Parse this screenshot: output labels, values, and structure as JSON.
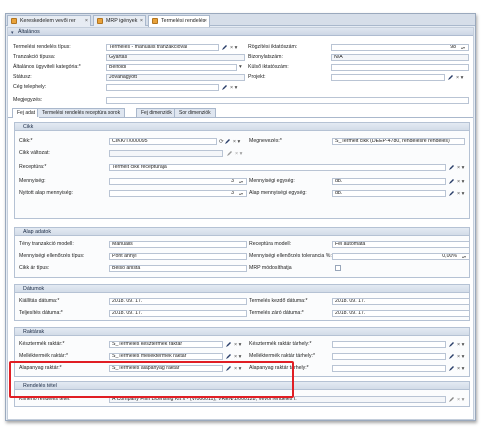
{
  "tabs": [
    {
      "label": "Kereskedelem vevői rer",
      "close": "×"
    },
    {
      "label": "MRP igények",
      "close": "×"
    },
    {
      "label": "Termelési rendelés",
      "close": "×"
    }
  ],
  "general": {
    "header": "Általános",
    "left": [
      {
        "label": "Termelési rendelés típus:",
        "value": "Termelés - manuális tranzakcióval"
      },
      {
        "label": "Tranzakció típusa:",
        "value": "Gyártás"
      },
      {
        "label": "Általános ügyviteli kategória:*",
        "value": "Belföldi"
      },
      {
        "label": "Státusz:",
        "value": "Jóváhagyott"
      },
      {
        "label": "Cég telephely:",
        "value": ""
      }
    ],
    "right": [
      {
        "label": "Rögzítési iktatószám:",
        "value": "98"
      },
      {
        "label": "Bizonylatszám:",
        "value": "N/A"
      },
      {
        "label": "Külső iktatószám:",
        "value": ""
      },
      {
        "label": "Projekt:",
        "value": ""
      }
    ],
    "remark_label": "Megjegyzés:",
    "remark_value": ""
  },
  "page_tabs": [
    "Fej adat",
    "Termelési rendelés receptúra sorok",
    "Fej dimenziók",
    "Sor dimenziók"
  ],
  "cikk": {
    "header": "Cikk",
    "cikk_label": "Cikk:*",
    "cikk_value": "CIKK/T/000095",
    "megnev_label": "Megnevezés:*",
    "megnev_value": "S_Termelt cikk (DEEP-4780, rendelésre rendelés)",
    "valtozat_label": "Cikk változat:",
    "valtozat_value": "",
    "receptura_label": "Receptúra:*",
    "receptura_value": "Termelt cikk receptúrája",
    "menny_label": "Mennyiség:",
    "menny_value": "3",
    "menny_egys_label": "Mennyiségi egység:",
    "menny_egys_value": "db.",
    "nyitott_label": "Nyitott alap mennyiség:",
    "nyitott_value": "3",
    "alap_egys_label": "Alap mennyiségi egység:",
    "alap_egys_value": "db."
  },
  "alap": {
    "header": "Alap adatok",
    "rows": [
      {
        "l1": "Tény tranzakció modell:",
        "v1": "Manuális",
        "l2": "Receptúra modell:",
        "v2": "Fél automata"
      },
      {
        "l1": "Mennyiségi ellenőrzés típus:",
        "v1": "Pont annyi",
        "l2": "Mennyiségi ellenőrzés tolerancia %:",
        "v2": "0,00%"
      },
      {
        "l1": "Cikk ár típus:",
        "v1": "Belső árlista",
        "l2": "MRP módosíthatja",
        "v2": ""
      }
    ]
  },
  "datumok": {
    "header": "Dátumok",
    "rows": [
      {
        "l1": "Kiállítás dátuma:*",
        "v1": "2018. 09. 17.",
        "l2": "Termelés kezdő dátuma:*",
        "v2": "2018. 09. 17."
      },
      {
        "l1": "Teljesítés dátuma:*",
        "v1": "2018. 09. 17.",
        "l2": "Termelés záró dátuma:*",
        "v2": "2018. 09. 17."
      }
    ]
  },
  "raktarak": {
    "header": "Raktárak",
    "rows": [
      {
        "l1": "Késztermék raktár:*",
        "v1": "S_Termelés késztermék raktár",
        "l2": "Késztermék raktár tárhely:*",
        "v2": ""
      },
      {
        "l1": "Melléktermék raktár:*",
        "v1": "S_Termelés melléktermék raktár",
        "l2": "Melléktermék raktár tárhely:*",
        "v2": ""
      },
      {
        "l1": "Alapanyag raktár:*",
        "v1": "S_Termelés alapanyag raktár",
        "l2": "Alapanyag raktár tárhely:*",
        "v2": ""
      }
    ]
  },
  "rendeles": {
    "header": "Rendelés tétel",
    "label": "Kimenő rendelés tétel:",
    "value": "A Company Film Licensing Kft x - (V/000011), VREN/1/000128, Vevői rendelés I."
  },
  "icons": {
    "edit": "pencil-icon",
    "clear": "×",
    "dropdown": "▾",
    "collapse": "▾"
  }
}
